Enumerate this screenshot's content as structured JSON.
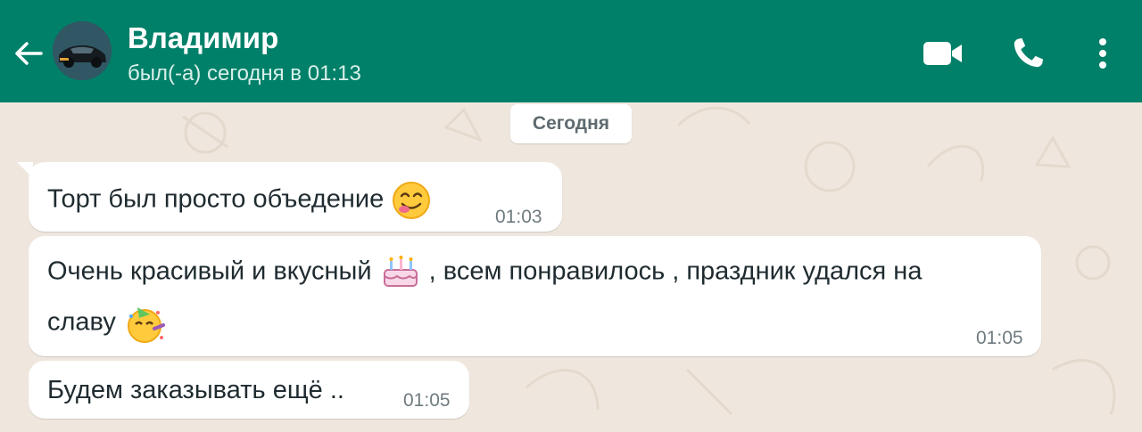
{
  "header": {
    "contact_name": "Владимир",
    "status": "был(-а) сегодня в 01:13",
    "icons": [
      "back-arrow-icon",
      "avatar-car-icon",
      "video-call-icon",
      "phone-icon",
      "more-vert-icon"
    ]
  },
  "chat": {
    "date_separator": "Сегодня",
    "messages": [
      {
        "text": "Торт был просто объедение",
        "emoji": "savoring-food-face",
        "time": "01:03"
      },
      {
        "line1": "Очень красивый и вкусный",
        "line1_end": ", всем понравилось , праздник удался на",
        "line2": "славу",
        "emoji_1": "birthday-cake",
        "emoji_2": "partying-face",
        "time": "01:05"
      },
      {
        "text": "Будем заказывать ещё ..",
        "time": "01:05"
      }
    ]
  },
  "colors": {
    "header": "#008069",
    "chat_background": "#efe7de",
    "bubble": "#ffffff"
  }
}
